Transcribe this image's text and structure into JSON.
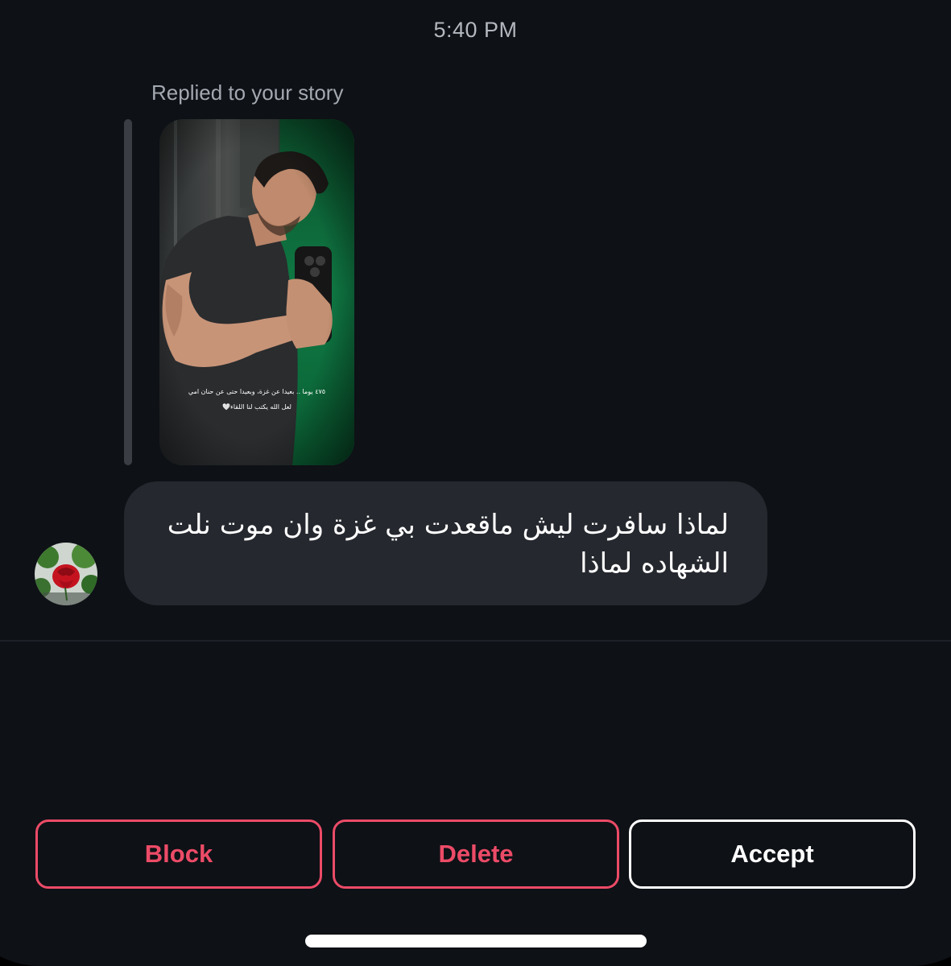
{
  "thread": {
    "timestamp": "5:40 PM",
    "story_reply": {
      "label": "Replied to your story",
      "story_caption_line1": "٤٧٥ يوما .. بعيدا عن غزة، وبعيدا حتى عن حنان امي",
      "story_caption_line2": "لعل الله يكتب لنا اللقاء🤍"
    },
    "message": {
      "line1": "لماذا سافرت ليش ماقعدت بي غزة وان موت نلت",
      "line2": "الشهاده لماذا"
    },
    "avatar": {
      "icon": "rose-avatar-icon"
    }
  },
  "actions": {
    "block_label": "Block",
    "delete_label": "Delete",
    "accept_label": "Accept"
  },
  "colors": {
    "background": "#0e1116",
    "bubble": "#25282e",
    "danger": "#ec4b67",
    "primary_outline": "#ffffff",
    "muted_text": "#a4a8b0"
  }
}
